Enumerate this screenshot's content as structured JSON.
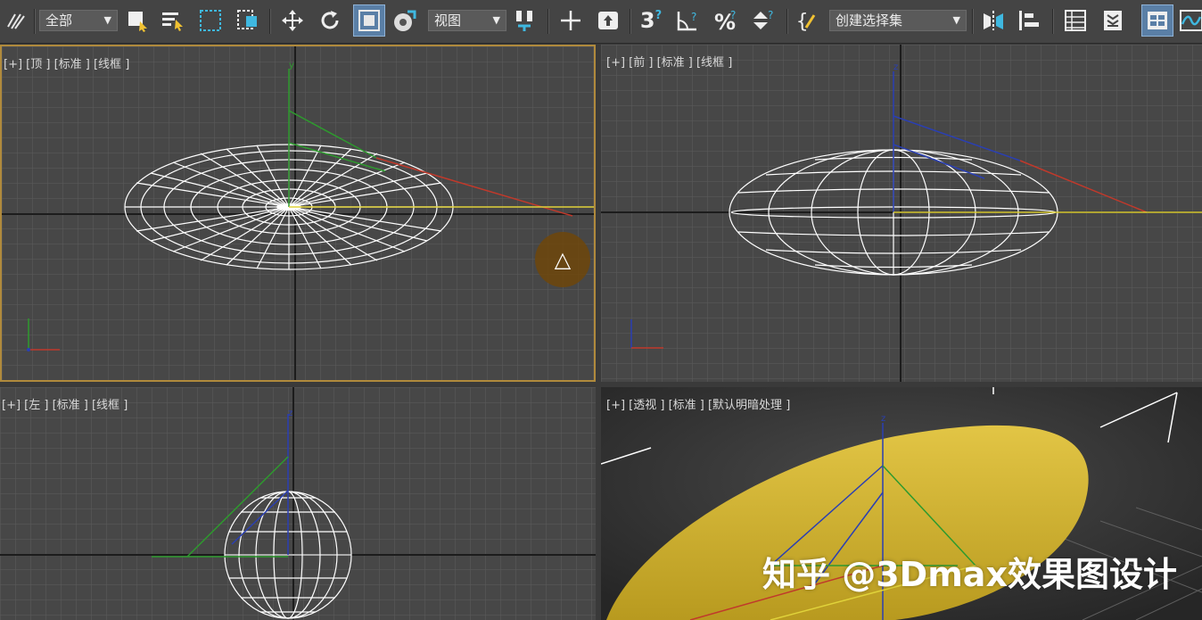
{
  "toolbar": {
    "selection_filter": "全部",
    "reference_coord": "视图",
    "named_selection": "创建选择集",
    "snap_label": "3"
  },
  "viewports": {
    "top": "[+] [顶 ] [标准 ] [线框 ]",
    "front": "[+] [前 ] [标准 ] [线框 ]",
    "left": "[+] [左 ] [标准 ] [线框 ]",
    "perspective": "[+] [透视 ] [标准 ] [默认明暗处理 ]"
  },
  "watermark": "知乎 @3Dmax效果图设计",
  "colors": {
    "viewport_bg": "#474747",
    "grid": "#5c5c5c",
    "axis_dark": "#1c1c1c",
    "wire": "#ffffff",
    "axis_x": "#c0392b",
    "axis_y": "#2e9a2e",
    "axis_z": "#2a3fb3",
    "object_yellow": "#d6b531",
    "active_border": "#b08a3c"
  }
}
